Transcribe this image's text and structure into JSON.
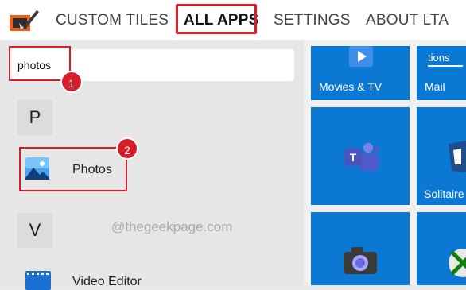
{
  "nav": {
    "items": [
      {
        "label": "CUSTOM TILES"
      },
      {
        "label": "ALL APPS"
      },
      {
        "label": "SETTINGS"
      },
      {
        "label": "ABOUT LTA"
      }
    ]
  },
  "search": {
    "value": "photos"
  },
  "annotations": {
    "step1": "1",
    "step2": "2"
  },
  "groups": [
    {
      "letter": "P",
      "apps": [
        {
          "name": "Photos",
          "icon": "photos-icon"
        }
      ]
    },
    {
      "letter": "V",
      "apps": [
        {
          "name": "Video Editor",
          "icon": "video-editor-icon"
        }
      ]
    }
  ],
  "watermark": "@thegeekpage.com",
  "tiles": [
    {
      "label": "Movies & TV",
      "icon": "play-icon"
    },
    {
      "label": "Mail",
      "top_text": "tions",
      "icon": "mail-icon"
    },
    {
      "label": "",
      "icon": "teams-icon"
    },
    {
      "label": "Solitaire",
      "icon": "solitaire-icon"
    },
    {
      "label": "",
      "icon": "camera-icon"
    },
    {
      "label": "",
      "icon": "xbox-icon"
    }
  ],
  "colors": {
    "highlight": "#d91c2a",
    "tile": "#0b78d4"
  }
}
